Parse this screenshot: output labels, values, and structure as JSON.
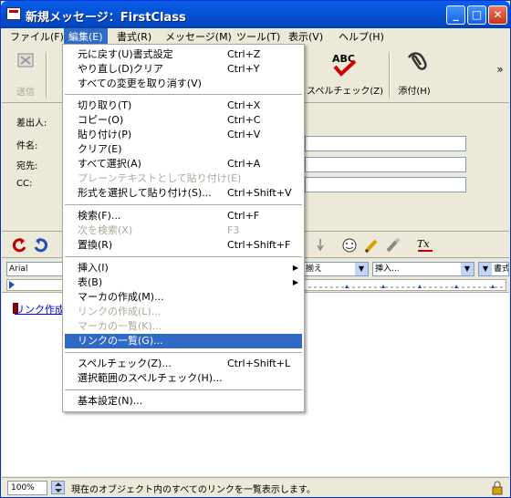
{
  "window": {
    "title": "新規メッセージ：FirstClass"
  },
  "title_buttons": {
    "minimize": "_",
    "maximize": "□",
    "close": "✕"
  },
  "menubar": [
    {
      "label": "ファイル(F)",
      "active": false
    },
    {
      "label": "編集(E)",
      "active": true
    },
    {
      "label": "書式(R)",
      "active": false
    },
    {
      "label": "メッセージ(M)",
      "active": false
    },
    {
      "label": "ツール(T)",
      "active": false
    },
    {
      "label": "表示(V)",
      "active": false
    },
    {
      "label": "ヘルプ(H)",
      "active": false
    }
  ],
  "toolbar": {
    "send_label": "送信",
    "spellcheck_label": "スペルチェック(Z)",
    "attach_label": "添付(H)",
    "overflow": "»"
  },
  "fields": {
    "from_label": "差出人:",
    "subject_label": "件名:",
    "to_label": "宛先:",
    "cc_label": "CC:"
  },
  "format": {
    "font": "Arial",
    "combo2": "揃え",
    "combo3": "挿入...",
    "combo4": "書式設"
  },
  "editor": {
    "link_text": "リンク作成"
  },
  "statusbar": {
    "zoom": "100%",
    "text": "現在のオブジェクト内のすべてのリンクを一覧表示します。"
  },
  "edit_menu": [
    {
      "label": "元に戻す(U)書式設定",
      "shortcut": "Ctrl+Z",
      "state": "normal"
    },
    {
      "label": "やり直し(D)クリア",
      "shortcut": "Ctrl+Y",
      "state": "normal"
    },
    {
      "label": "すべての変更を取り消す(V)",
      "shortcut": "",
      "state": "normal"
    },
    {
      "separator": true
    },
    {
      "label": "切り取り(T)",
      "shortcut": "Ctrl+X",
      "state": "normal"
    },
    {
      "label": "コピー(O)",
      "shortcut": "Ctrl+C",
      "state": "normal"
    },
    {
      "label": "貼り付け(P)",
      "shortcut": "Ctrl+V",
      "state": "normal"
    },
    {
      "label": "クリア(E)",
      "shortcut": "",
      "state": "normal"
    },
    {
      "label": "すべて選択(A)",
      "shortcut": "Ctrl+A",
      "state": "normal"
    },
    {
      "label": "プレーンテキストとして貼り付け(E)",
      "shortcut": "",
      "state": "disabled"
    },
    {
      "label": "形式を選択して貼り付け(S)...",
      "shortcut": "Ctrl+Shift+V",
      "state": "normal"
    },
    {
      "separator": true
    },
    {
      "label": "検索(F)...",
      "shortcut": "Ctrl+F",
      "state": "normal"
    },
    {
      "label": "次を検索(X)",
      "shortcut": "F3",
      "state": "disabled"
    },
    {
      "label": "置換(R)",
      "shortcut": "Ctrl+Shift+F",
      "state": "normal"
    },
    {
      "separator": true
    },
    {
      "label": "挿入(I)",
      "shortcut": "",
      "state": "normal",
      "submenu": true
    },
    {
      "label": "表(B)",
      "shortcut": "",
      "state": "normal",
      "submenu": true
    },
    {
      "label": "マーカの作成(M)...",
      "shortcut": "",
      "state": "normal"
    },
    {
      "label": "リンクの作成(L)...",
      "shortcut": "",
      "state": "disabled"
    },
    {
      "label": "マーカの一覧(K)...",
      "shortcut": "",
      "state": "disabled"
    },
    {
      "label": "リンクの一覧(G)...",
      "shortcut": "",
      "state": "highlighted"
    },
    {
      "separator": true
    },
    {
      "label": "スペルチェック(Z)...",
      "shortcut": "Ctrl+Shift+L",
      "state": "normal"
    },
    {
      "label": "選択範囲のスペルチェック(H)...",
      "shortcut": "",
      "state": "normal"
    },
    {
      "separator": true
    },
    {
      "label": "基本設定(N)...",
      "shortcut": "",
      "state": "normal"
    }
  ]
}
